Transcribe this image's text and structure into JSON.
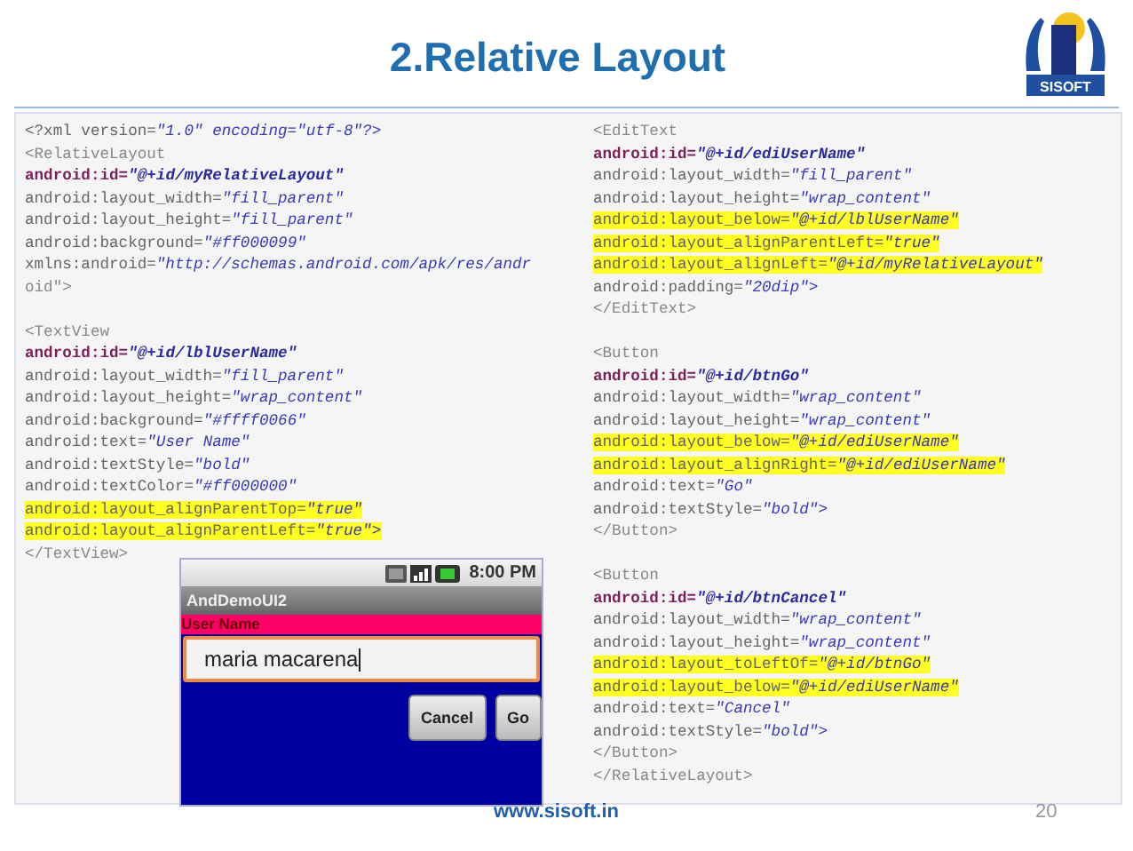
{
  "title": "2.Relative Layout",
  "logo": {
    "text": "SISOFT"
  },
  "code_columns": [
    {
      "lines": [
        {
          "kind": "decl",
          "text": "<?xml version=\"1.0\" encoding=\"utf-8\"?>",
          "highlighted": false
        },
        {
          "kind": "tag",
          "text": "<RelativeLayout",
          "highlighted": false
        },
        {
          "kind": "id",
          "text": "android:id=\"@+id/myRelativeLayout\"",
          "highlighted": false
        },
        {
          "kind": "attr",
          "text": "android:layout_width=\"fill_parent\"",
          "highlighted": false
        },
        {
          "kind": "attr",
          "text": "android:layout_height=\"fill_parent\"",
          "highlighted": false
        },
        {
          "kind": "attr",
          "text": "android:background=\"#ff000099\"",
          "highlighted": false
        },
        {
          "kind": "attr",
          "text": "xmlns:android=\"http://schemas.android.com/apk/res/andr",
          "highlighted": false
        },
        {
          "kind": "tag",
          "text": "oid\">",
          "highlighted": false
        },
        {
          "kind": "blank"
        },
        {
          "kind": "tag",
          "text": "<TextView",
          "highlighted": false
        },
        {
          "kind": "id",
          "text": "android:id=\"@+id/lblUserName\"",
          "highlighted": false
        },
        {
          "kind": "attr",
          "text": "android:layout_width=\"fill_parent\"",
          "highlighted": false
        },
        {
          "kind": "attr",
          "text": "android:layout_height=\"wrap_content\"",
          "highlighted": false
        },
        {
          "kind": "attr",
          "text": "android:background=\"#ffff0066\"",
          "highlighted": false
        },
        {
          "kind": "attr",
          "text": "android:text=\"User Name\"",
          "highlighted": false
        },
        {
          "kind": "attr",
          "text": "android:textStyle=\"bold\"",
          "highlighted": false
        },
        {
          "kind": "attr",
          "text": "android:textColor=\"#ff000000\"",
          "highlighted": false
        },
        {
          "kind": "attr",
          "text": "android:layout_alignParentTop=\"true\"",
          "highlighted": true
        },
        {
          "kind": "attr",
          "text": "android:layout_alignParentLeft=\"true\">",
          "highlighted": true
        },
        {
          "kind": "tag",
          "text": "</TextView>",
          "highlighted": false
        }
      ]
    },
    {
      "lines": [
        {
          "kind": "tag",
          "text": "<EditText",
          "highlighted": false
        },
        {
          "kind": "id",
          "text": "android:id=\"@+id/ediUserName\"",
          "highlighted": false
        },
        {
          "kind": "attr",
          "text": "android:layout_width=\"fill_parent\"",
          "highlighted": false
        },
        {
          "kind": "attr",
          "text": "android:layout_height=\"wrap_content\"",
          "highlighted": false
        },
        {
          "kind": "attr",
          "text": "android:layout_below=\"@+id/lblUserName\"",
          "highlighted": true
        },
        {
          "kind": "attr",
          "text": "android:layout_alignParentLeft=\"true\"",
          "highlighted": true
        },
        {
          "kind": "attr",
          "text": "android:layout_alignLeft=\"@+id/myRelativeLayout\"",
          "highlighted": true
        },
        {
          "kind": "attr",
          "text": "android:padding=\"20dip\">",
          "highlighted": false
        },
        {
          "kind": "tag",
          "text": "</EditText>",
          "highlighted": false
        },
        {
          "kind": "blank"
        },
        {
          "kind": "tag",
          "text": "<Button",
          "highlighted": false
        },
        {
          "kind": "id",
          "text": "android:id=\"@+id/btnGo\"",
          "highlighted": false
        },
        {
          "kind": "attr",
          "text": "android:layout_width=\"wrap_content\"",
          "highlighted": false
        },
        {
          "kind": "attr",
          "text": "android:layout_height=\"wrap_content\"",
          "highlighted": false
        },
        {
          "kind": "attr",
          "text": "android:layout_below=\"@+id/ediUserName\"",
          "highlighted": true
        },
        {
          "kind": "attr",
          "text": "android:layout_alignRight=\"@+id/ediUserName\"",
          "highlighted": true
        },
        {
          "kind": "attr",
          "text": "android:text=\"Go\"",
          "highlighted": false
        },
        {
          "kind": "attr",
          "text": "android:textStyle=\"bold\">",
          "highlighted": false
        },
        {
          "kind": "tag",
          "text": "</Button>",
          "highlighted": false
        },
        {
          "kind": "blank"
        },
        {
          "kind": "tag",
          "text": "<Button",
          "highlighted": false
        },
        {
          "kind": "id",
          "text": "android:id=\"@+id/btnCancel\"",
          "highlighted": false
        },
        {
          "kind": "attr",
          "text": "android:layout_width=\"wrap_content\"",
          "highlighted": false
        },
        {
          "kind": "attr",
          "text": "android:layout_height=\"wrap_content\"",
          "highlighted": false
        },
        {
          "kind": "attr",
          "text": "android:layout_toLeftOf=\"@+id/btnGo\"",
          "highlighted": true
        },
        {
          "kind": "attr",
          "text": "android:layout_below=\"@+id/ediUserName\"",
          "highlighted": true
        },
        {
          "kind": "attr",
          "text": "android:text=\"Cancel\"",
          "highlighted": false
        },
        {
          "kind": "attr",
          "text": "android:textStyle=\"bold\">",
          "highlighted": false
        },
        {
          "kind": "tag",
          "text": "</Button>",
          "highlighted": false
        },
        {
          "kind": "tag",
          "text": "</RelativeLayout>",
          "highlighted": false
        }
      ]
    }
  ],
  "emulator": {
    "time": "8:00 PM",
    "app_title": "AndDemoUI2",
    "label": "User Name",
    "field_value": "maria macarena",
    "buttons": [
      "Cancel",
      "Go"
    ]
  },
  "footer": {
    "website": "www.sisoft.in",
    "page_number": "20"
  }
}
